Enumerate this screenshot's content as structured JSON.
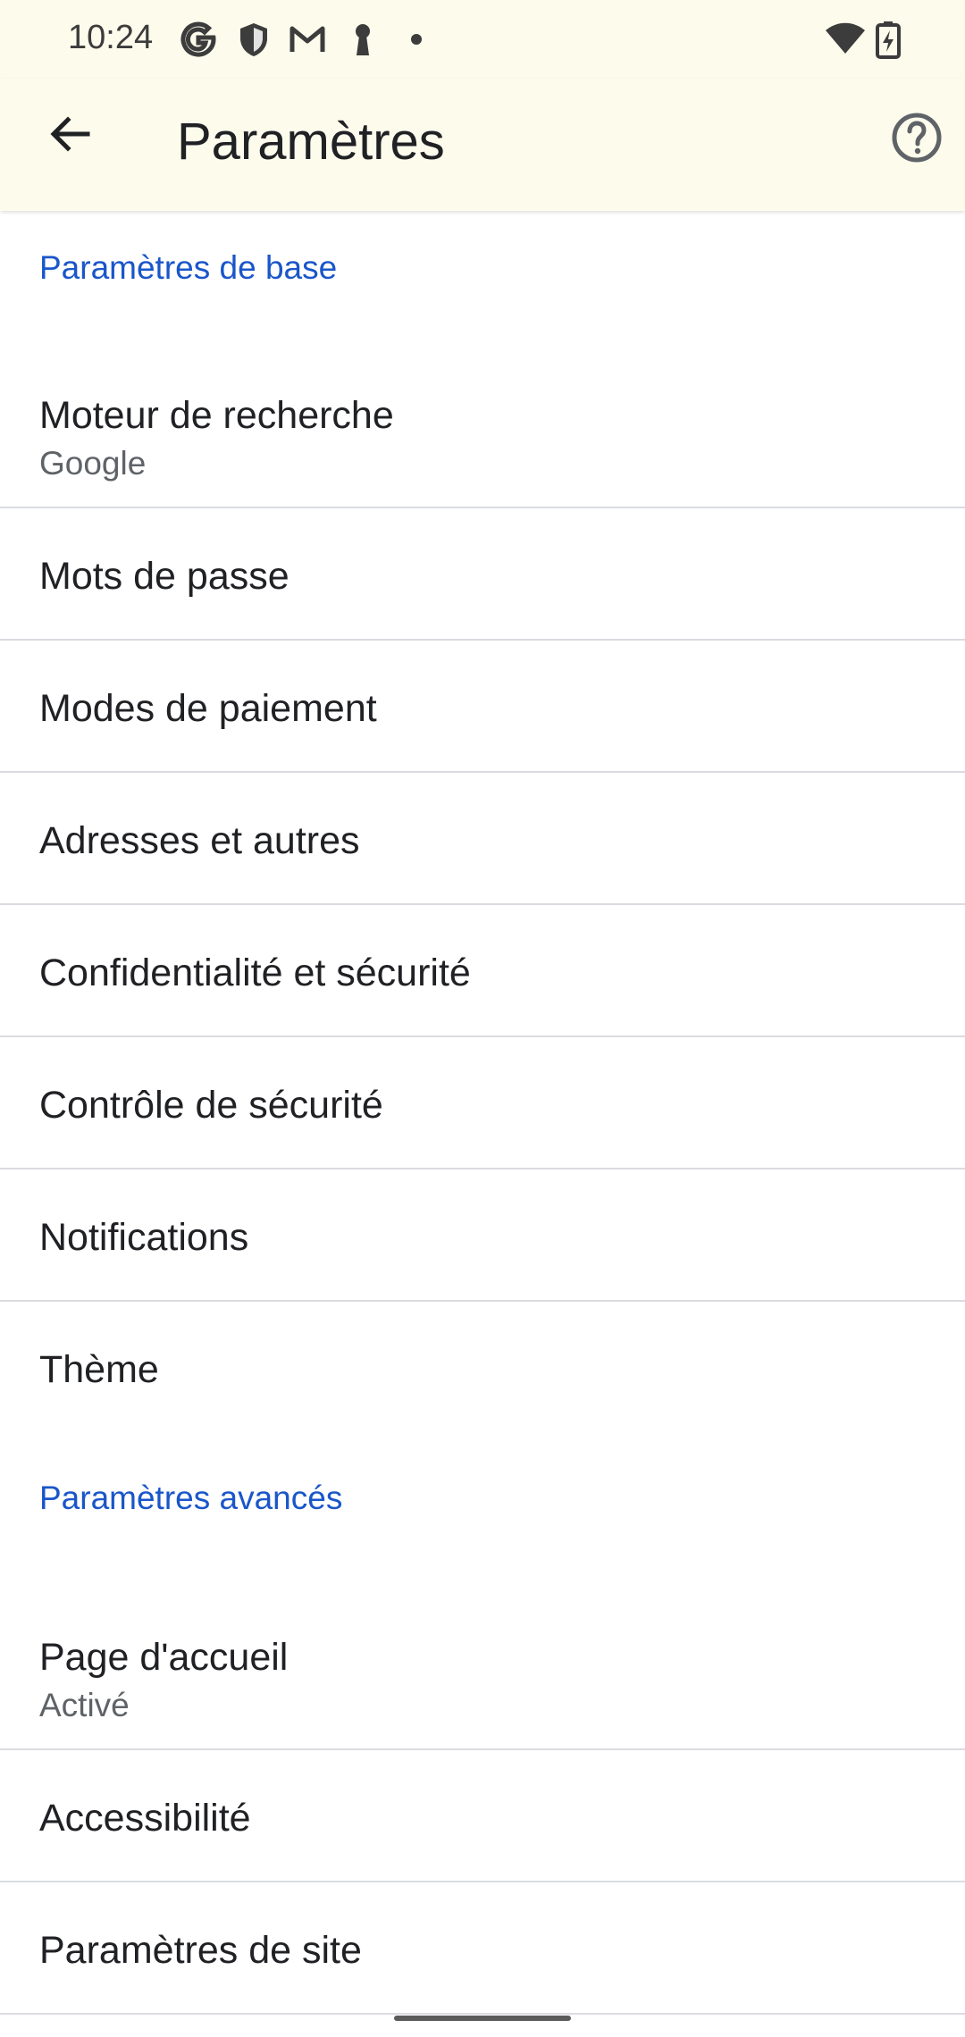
{
  "status_bar": {
    "time": "10:24",
    "icons": [
      "google-icon",
      "shield-icon",
      "gmail-icon",
      "keyhole-icon",
      "dot-icon",
      "wifi-icon",
      "battery-charging-icon"
    ]
  },
  "app_bar": {
    "title": "Paramètres",
    "back_icon": "arrow-back-icon",
    "help_icon": "help-circle-icon"
  },
  "sections": {
    "basic": {
      "header": "Paramètres de base",
      "items": [
        {
          "label": "Moteur de recherche",
          "sub": "Google"
        },
        {
          "label": "Mots de passe"
        },
        {
          "label": "Modes de paiement"
        },
        {
          "label": "Adresses et autres"
        },
        {
          "label": "Confidentialité et sécurité"
        },
        {
          "label": "Contrôle de sécurité"
        },
        {
          "label": "Notifications"
        },
        {
          "label": "Thème"
        }
      ]
    },
    "advanced": {
      "header": "Paramètres avancés",
      "items": [
        {
          "label": "Page d'accueil",
          "sub": "Activé"
        },
        {
          "label": "Accessibilité"
        },
        {
          "label": "Paramètres de site"
        }
      ]
    }
  },
  "colors": {
    "bar_background": "#fdfcec",
    "section_header": "#1a56c9",
    "divider": "#dadce0",
    "primary_text": "#202124",
    "secondary_text": "#5f6368"
  }
}
